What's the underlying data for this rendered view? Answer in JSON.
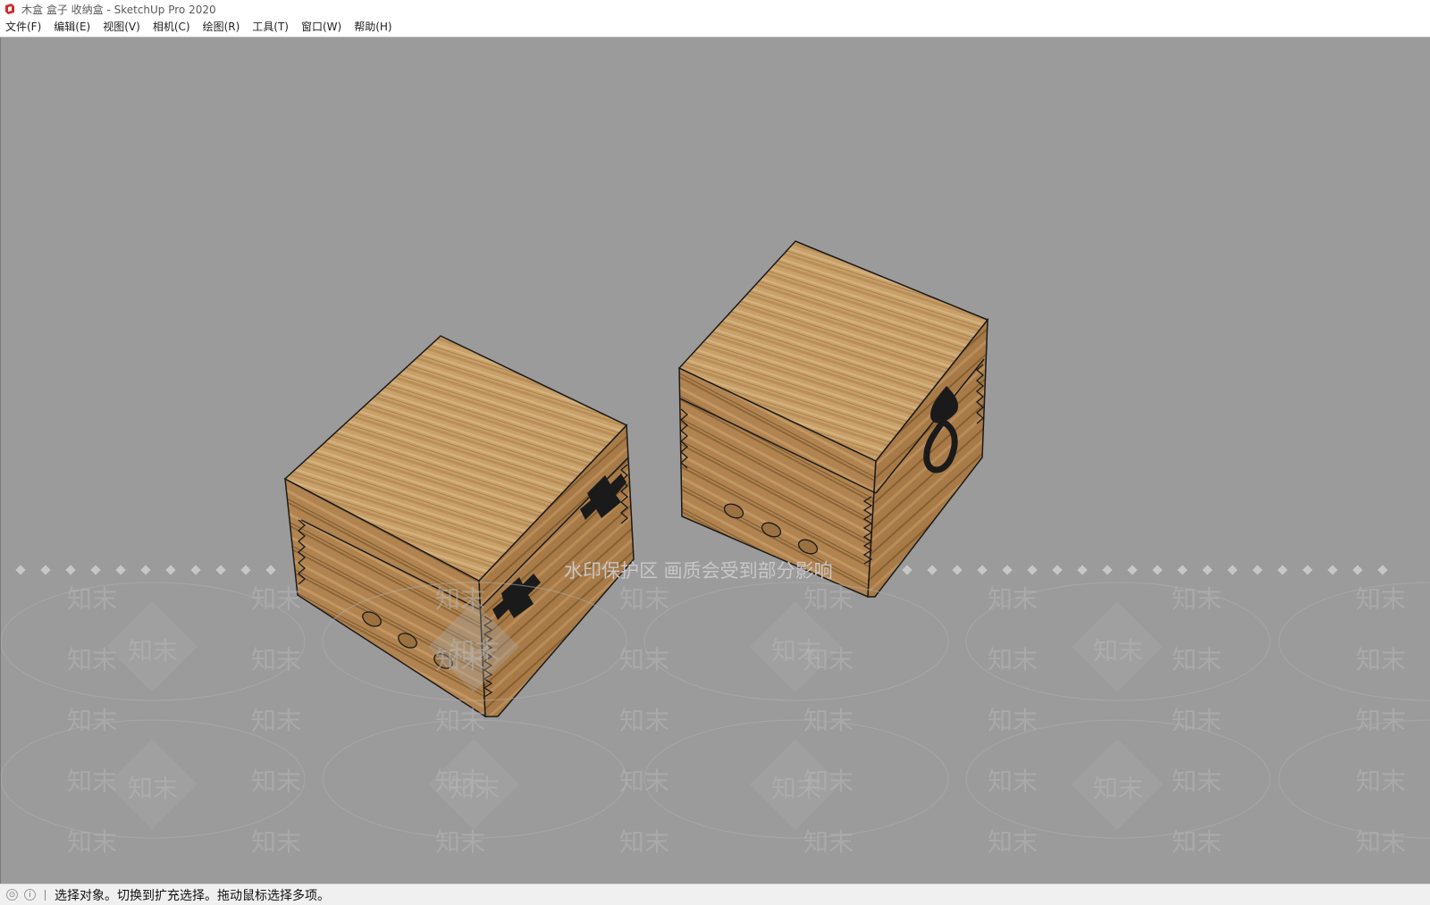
{
  "window": {
    "title": "木盒 盒子 收纳盒 - SketchUp Pro 2020"
  },
  "menu": {
    "items": [
      "文件(F)",
      "编辑(E)",
      "视图(V)",
      "相机(C)",
      "绘图(R)",
      "工具(T)",
      "窗口(W)",
      "帮助(H)"
    ]
  },
  "viewport": {
    "background": "#9b9b9b",
    "wood_color": "#c49a62",
    "hardware_color": "#1a1a1a"
  },
  "watermark": {
    "banner": "水印保护区   画质会受到部分影响",
    "mark": "知末"
  },
  "status": {
    "icons": [
      "geo-location-icon",
      "info-icon"
    ],
    "message": "选择对象。切换到扩充选择。拖动鼠标选择多项。"
  }
}
